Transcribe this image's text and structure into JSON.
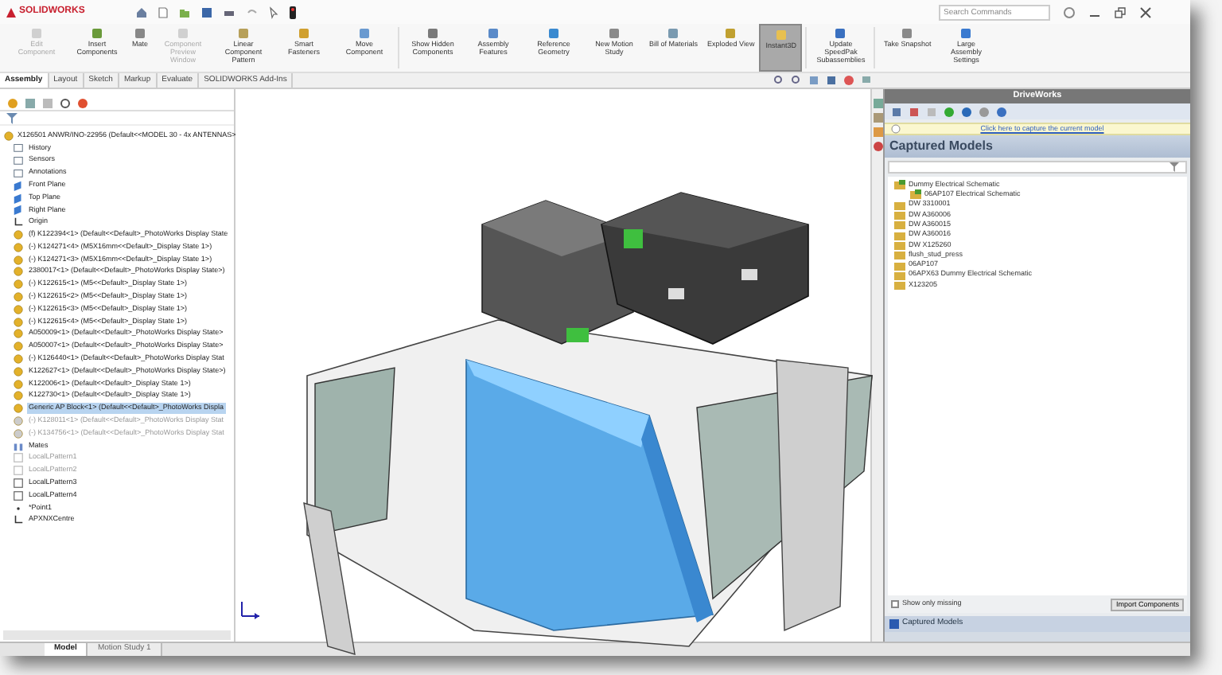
{
  "title_bar": {
    "logo": "SOLIDWORKS",
    "search": {
      "placeholder": "Search Commands"
    }
  },
  "ribbon": [
    {
      "label": "Edit Component",
      "disabled": true,
      "selected": false
    },
    {
      "label": "Insert Components",
      "disabled": false,
      "selected": false
    },
    {
      "label": "Mate",
      "disabled": false,
      "selected": false
    },
    {
      "label": "Component Preview Window",
      "disabled": true,
      "selected": false
    },
    {
      "label": "Linear Component Pattern",
      "disabled": false,
      "selected": false
    },
    {
      "label": "Smart Fasteners",
      "disabled": false,
      "selected": false
    },
    {
      "label": "Move Component",
      "disabled": false,
      "selected": false
    },
    {
      "label": "Show Hidden Components",
      "disabled": false,
      "selected": false
    },
    {
      "label": "Assembly Features",
      "disabled": false,
      "selected": false
    },
    {
      "label": "Reference Geometry",
      "disabled": false,
      "selected": false
    },
    {
      "label": "New Motion Study",
      "disabled": false,
      "selected": false
    },
    {
      "label": "Bill of Materials",
      "disabled": false,
      "selected": false
    },
    {
      "label": "Exploded View",
      "disabled": false,
      "selected": false
    },
    {
      "label": "Instant3D",
      "disabled": false,
      "selected": true
    },
    {
      "label": "Update SpeedPak Subassemblies",
      "disabled": false,
      "selected": false
    },
    {
      "label": "Take Snapshot",
      "disabled": false,
      "selected": false
    },
    {
      "label": "Large Assembly Settings",
      "disabled": false,
      "selected": false
    }
  ],
  "tabs": [
    {
      "label": "Assembly",
      "selected": true
    },
    {
      "label": "Layout",
      "selected": false
    },
    {
      "label": "Sketch",
      "selected": false
    },
    {
      "label": "Markup",
      "selected": false
    },
    {
      "label": "Evaluate",
      "selected": false
    },
    {
      "label": "SOLIDWORKS Add-Ins",
      "selected": false
    }
  ],
  "feature_tree": {
    "root": "X126501 ANWR/INO-22956 (Default<<MODEL 30 - 4x ANTENNAS>",
    "items": [
      {
        "kind": "folder",
        "label": "History",
        "selected": false,
        "disabled": false
      },
      {
        "kind": "folder",
        "label": "Sensors",
        "selected": false,
        "disabled": false
      },
      {
        "kind": "folder",
        "label": "Annotations",
        "selected": false,
        "disabled": false
      },
      {
        "kind": "plane",
        "label": "Front Plane",
        "selected": false,
        "disabled": false
      },
      {
        "kind": "plane",
        "label": "Top Plane",
        "selected": false,
        "disabled": false
      },
      {
        "kind": "plane",
        "label": "Right Plane",
        "selected": false,
        "disabled": false
      },
      {
        "kind": "origin",
        "label": "Origin",
        "selected": false,
        "disabled": false
      },
      {
        "kind": "part",
        "label": "(f) K122394<1> (Default<<Default>_PhotoWorks Display State",
        "selected": false,
        "disabled": false
      },
      {
        "kind": "part",
        "label": "(-) K124271<4> (M5X16mm<<Default>_Display State 1>)",
        "selected": false,
        "disabled": false
      },
      {
        "kind": "part",
        "label": "(-) K124271<3> (M5X16mm<<Default>_Display State 1>)",
        "selected": false,
        "disabled": false
      },
      {
        "kind": "part",
        "label": "2380017<1> (Default<<Default>_PhotoWorks Display State>)",
        "selected": false,
        "disabled": false
      },
      {
        "kind": "part",
        "label": "(-) K122615<1> (M5<<Default>_Display State 1>)",
        "selected": false,
        "disabled": false
      },
      {
        "kind": "part",
        "label": "(-) K122615<2> (M5<<Default>_Display State 1>)",
        "selected": false,
        "disabled": false
      },
      {
        "kind": "part",
        "label": "(-) K122615<3> (M5<<Default>_Display State 1>)",
        "selected": false,
        "disabled": false
      },
      {
        "kind": "part",
        "label": "(-) K122615<4> (M5<<Default>_Display State 1>)",
        "selected": false,
        "disabled": false
      },
      {
        "kind": "part",
        "label": "A050009<1> (Default<<Default>_PhotoWorks Display State>",
        "selected": false,
        "disabled": false
      },
      {
        "kind": "part",
        "label": "A050007<1> (Default<<Default>_PhotoWorks Display State>",
        "selected": false,
        "disabled": false
      },
      {
        "kind": "part",
        "label": "(-) K126440<1> (Default<<Default>_PhotoWorks Display Stat",
        "selected": false,
        "disabled": false
      },
      {
        "kind": "part",
        "label": "K122627<1> (Default<<Default>_PhotoWorks Display State>)",
        "selected": false,
        "disabled": false
      },
      {
        "kind": "part",
        "label": "K122006<1> (Default<<Default>_Display State 1>)",
        "selected": false,
        "disabled": false
      },
      {
        "kind": "part",
        "label": "K122730<1> (Default<<Default>_Display State 1>)",
        "selected": false,
        "disabled": false
      },
      {
        "kind": "part",
        "label": "Generic AP Block<1> (Default<<Default>_PhotoWorks Displa",
        "selected": true,
        "disabled": false
      },
      {
        "kind": "part",
        "label": "(-) K128011<1> (Default<<Default>_PhotoWorks Display Stat",
        "selected": false,
        "disabled": true
      },
      {
        "kind": "part",
        "label": "(-) K134756<1> (Default<<Default>_PhotoWorks Display Stat",
        "selected": false,
        "disabled": true
      },
      {
        "kind": "mates",
        "label": "Mates",
        "selected": false,
        "disabled": false
      },
      {
        "kind": "pattern",
        "label": "LocalLPattern1",
        "selected": false,
        "disabled": true
      },
      {
        "kind": "pattern",
        "label": "LocalLPattern2",
        "selected": false,
        "disabled": true
      },
      {
        "kind": "pattern",
        "label": "LocalLPattern3",
        "selected": false,
        "disabled": false
      },
      {
        "kind": "pattern",
        "label": "LocalLPattern4",
        "selected": false,
        "disabled": false
      },
      {
        "kind": "point",
        "label": "*Point1",
        "selected": false,
        "disabled": false
      },
      {
        "kind": "origin",
        "label": "APXNXCentre",
        "selected": false,
        "disabled": false
      }
    ]
  },
  "bottom_tabs": [
    {
      "label": "Model",
      "selected": true
    },
    {
      "label": "Motion Study 1",
      "selected": false
    }
  ],
  "driveworks": {
    "title": "DriveWorks",
    "info": "Click here to capture the current model",
    "heading": "Captured Models",
    "models": [
      {
        "label": "Dummy Electrical Schematic",
        "children": [
          {
            "label": "06AP107 Electrical Schematic"
          }
        ]
      },
      {
        "label": "DW 3310001"
      },
      {
        "label": "DW A360006"
      },
      {
        "label": "DW A360015"
      },
      {
        "label": "DW A360016"
      },
      {
        "label": "DW X125260"
      },
      {
        "label": "flush_stud_press"
      },
      {
        "label": "06AP107"
      },
      {
        "label": "06APX63 Dummy Electrical Schematic"
      },
      {
        "label": "X123205"
      }
    ],
    "show_only_missing": {
      "label": "Show only missing",
      "checked": false
    },
    "import_button": "Import Components",
    "footer": "Captured Models"
  }
}
